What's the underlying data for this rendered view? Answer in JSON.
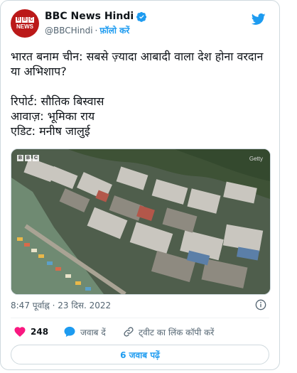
{
  "account": {
    "display_name": "BBC News Hindi",
    "handle": "@BBCHindi",
    "separator": "·",
    "follow_label": "फ़ॉलो करें",
    "avatar_letters": [
      "B",
      "B",
      "C"
    ],
    "avatar_word": "NEWS",
    "brand_color": "#bb1919",
    "verified_icon": "verified-badge-icon",
    "platform_icon": "twitter-bird-icon"
  },
  "tweet": {
    "text": "भारत बनाम चीन: सबसे ज़्यादा आबादी वाला देश होना वरदान या अभिशाप?\n\nरिपोर्ट: सौतिक बिस्वास\nआवाज़: भूमिका राय\nएडिट: मनीष जालुई"
  },
  "media": {
    "logo_letters": [
      "B",
      "B",
      "C"
    ],
    "credit": "Getty"
  },
  "meta": {
    "timestamp": "8:47 पूर्वाह्न · 23 दिस. 2022"
  },
  "actions": {
    "like_count": "248",
    "reply_label": "जवाब दें",
    "copy_link_label": "ट्वीट का लिंक कॉपी करें"
  },
  "replies_button": {
    "label": "6 जवाब पढ़ें"
  },
  "colors": {
    "accent": "#1d9bf0",
    "like": "#f91880",
    "muted": "#536471"
  }
}
